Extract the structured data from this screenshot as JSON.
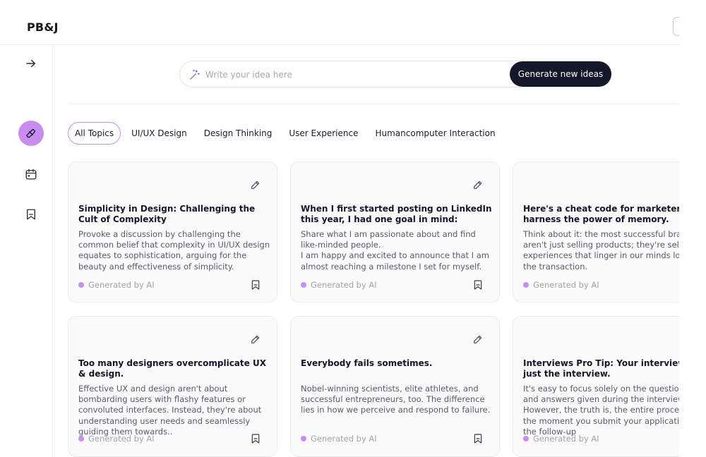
{
  "app": {
    "brand": "PB&J"
  },
  "search": {
    "placeholder": "Write your idea here",
    "value": "",
    "generate_label": "Generate new ideas"
  },
  "sidebar": {
    "items": [
      {
        "icon": "arrow-right-icon"
      },
      {
        "icon": "wand-icon",
        "active": true
      },
      {
        "icon": "calendar-icon"
      },
      {
        "icon": "bookmark-icon"
      }
    ]
  },
  "tabs": [
    {
      "label": "All Topics",
      "active": true
    },
    {
      "label": "UI/UX Design"
    },
    {
      "label": "Design Thinking"
    },
    {
      "label": "User Experience"
    },
    {
      "label": "Humancomputer Interaction"
    }
  ],
  "cards": [
    {
      "title": "Simplicity in Design: Challenging the Cult of Complexity",
      "body": "Provoke a discussion by challenging the common belief that complexity in UI/UX design equates to sophistication, arguing for the beauty and effectiveness of simplicity.",
      "footer": "Generated by AI"
    },
    {
      "title": "When I first started posting on LinkedIn this year, I had one goal in mind:",
      "body": "Share what I am passionate about and find like-minded people.\nI am happy and excited to announce that I am almost reaching a milestone I set for myself.",
      "footer": "Generated by AI"
    },
    {
      "title": "Here's a cheat code for marketers: harness the power of memory.",
      "body": "Think about it: the most successful brands aren't just selling products; they're selling experiences that linger in our minds long after the transaction.",
      "footer": "Generated by AI"
    },
    {
      "title": "Too many designers overcomplicate UX & design.",
      "body": "Effective UX and design aren't about bombarding users with flashy features or convoluted interfaces. Instead, they're about understanding user needs and seamlessly guiding them towards..",
      "footer": "Generated by AI"
    },
    {
      "title": "Everybody fails sometimes.",
      "body": "Nobel-winning scientists, elite athletes, and successful entrepreneurs, too. The difference lies in how we perceive and respond to failure.",
      "footer": "Generated by AI"
    },
    {
      "title": "Interviews Pro Tip: Your interview isn't just the interview.",
      "body": "It's easy to focus solely on the questions asked and answers given during the interview itself. However, the truth is, the entire process—from the moment you submit your application to the follow-up",
      "footer": "Generated by AI"
    }
  ]
}
